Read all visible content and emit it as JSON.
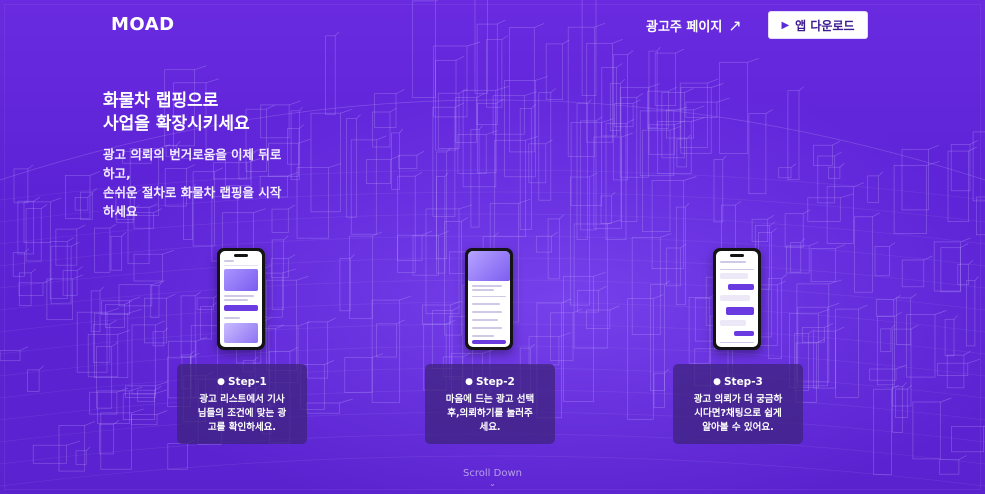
{
  "header": {
    "logo": "MOAD",
    "advertiser_link": "광고주 페이지",
    "advertiser_arrow": "↗",
    "download_label": "앱 다운로드",
    "download_icon": "play-icon"
  },
  "hero": {
    "title_line1": "화물차 랩핑으로",
    "title_line2": "사업을 확장시키세요",
    "sub_line1": "광고 의뢰의 번거로움을 이제 뒤로",
    "sub_line2": "하고,",
    "sub_line3": "손쉬운 절차로 화물차 랩핑을 시작",
    "sub_line4": "하세요"
  },
  "steps": [
    {
      "title": "Step-1",
      "line1": "광고 리스트에서 기사",
      "line2": "님들의 조건에 맞는 광",
      "line3": "고를 확인하세요."
    },
    {
      "title": "Step-2",
      "line1": "마음에 드는 광고 선택",
      "line2": "후,의뢰하기를 눌러주",
      "line3": "세요."
    },
    {
      "title": "Step-3",
      "line1": "광고 의뢰가 더 궁금하",
      "line2": "시다면?채팅으로 쉽게",
      "line3": "알아볼 수 있어요."
    }
  ],
  "scroll": {
    "label": "Scroll Down",
    "icon": "chevron-down-icon"
  },
  "colors": {
    "background": "#5c22d6",
    "card": "#3c2378",
    "button_text": "#3b1a90"
  }
}
